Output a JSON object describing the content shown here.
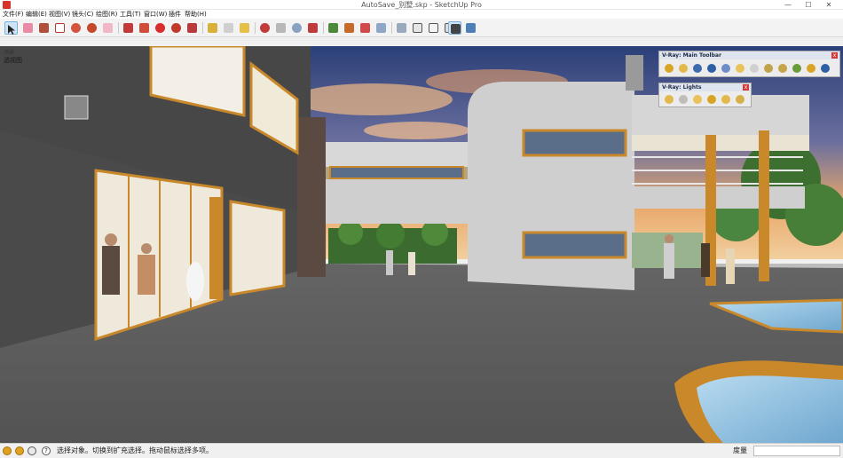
{
  "window": {
    "title": "AutoSave_别墅.skp - SketchUp Pro",
    "minimize_glyph": "—",
    "maximize_glyph": "☐",
    "close_glyph": "✕"
  },
  "menu": [
    "文件(F)",
    "编辑(E)",
    "视图(V)",
    "镜头(C)",
    "绘图(R)",
    "工具(T)",
    "窗口(W)",
    "插件",
    "帮助(H)"
  ],
  "toolbar": {
    "icons": [
      "select-icon",
      "eraser-icon",
      "paint-bucket-icon",
      "rectangle-icon",
      "circle-icon",
      "polygon-icon",
      "eraser-alt-icon",
      "push-pull-icon",
      "follow-me-icon",
      "move-icon",
      "rotate-icon",
      "scale-icon",
      "offset-icon",
      "tape-measure-icon",
      "dimension-icon",
      "protractor-icon",
      "text-icon",
      "axes-icon",
      "3d-text-icon",
      "orbit-icon",
      "pan-icon",
      "zoom-icon",
      "zoom-extents-icon",
      "layers-icon",
      "components-icon",
      "warehouse-icon",
      "share-icon",
      "section-plane-icon",
      "iso-view-icon",
      "top-view-icon",
      "front-view-icon",
      "xray-icon",
      "wireframe-icon",
      "shaded-icon"
    ]
  },
  "scene": {
    "label": "场景",
    "sub_label": "透视图"
  },
  "vfs_main": {
    "title": "V-Ray: Main Toolbar",
    "close": "x",
    "icons": [
      "render-icon",
      "settings-icon",
      "frame-buffer-icon",
      "rt-render-icon",
      "help-icon",
      "material-editor-icon",
      "light-icon",
      "sphere-icon",
      "fur-icon",
      "proxy-icon",
      "plane-icon",
      "clipper-icon"
    ]
  },
  "vfs_lights": {
    "title": "V-Ray: Lights",
    "close": "x",
    "icons": [
      "omni-light-icon",
      "rect-light-icon",
      "spot-light-icon",
      "dome-light-icon",
      "sphere-light-icon",
      "ies-light-icon"
    ]
  },
  "status": {
    "text": "选择对象。切换到扩充选择。拖动鼠标选择多项。",
    "measure_label": "度量",
    "measure_value": "",
    "icons": [
      "georef-icon",
      "credits-icon",
      "instructor-icon",
      "help-icon"
    ]
  },
  "colors": {
    "accent_wood": "#c9892a",
    "sky_top": "#2b3f78",
    "sky_glow": "#e9a86b",
    "wall_gray": "#4a4a4a",
    "ground": "#5a5a5a",
    "pool_water": "#9cc8e6"
  }
}
